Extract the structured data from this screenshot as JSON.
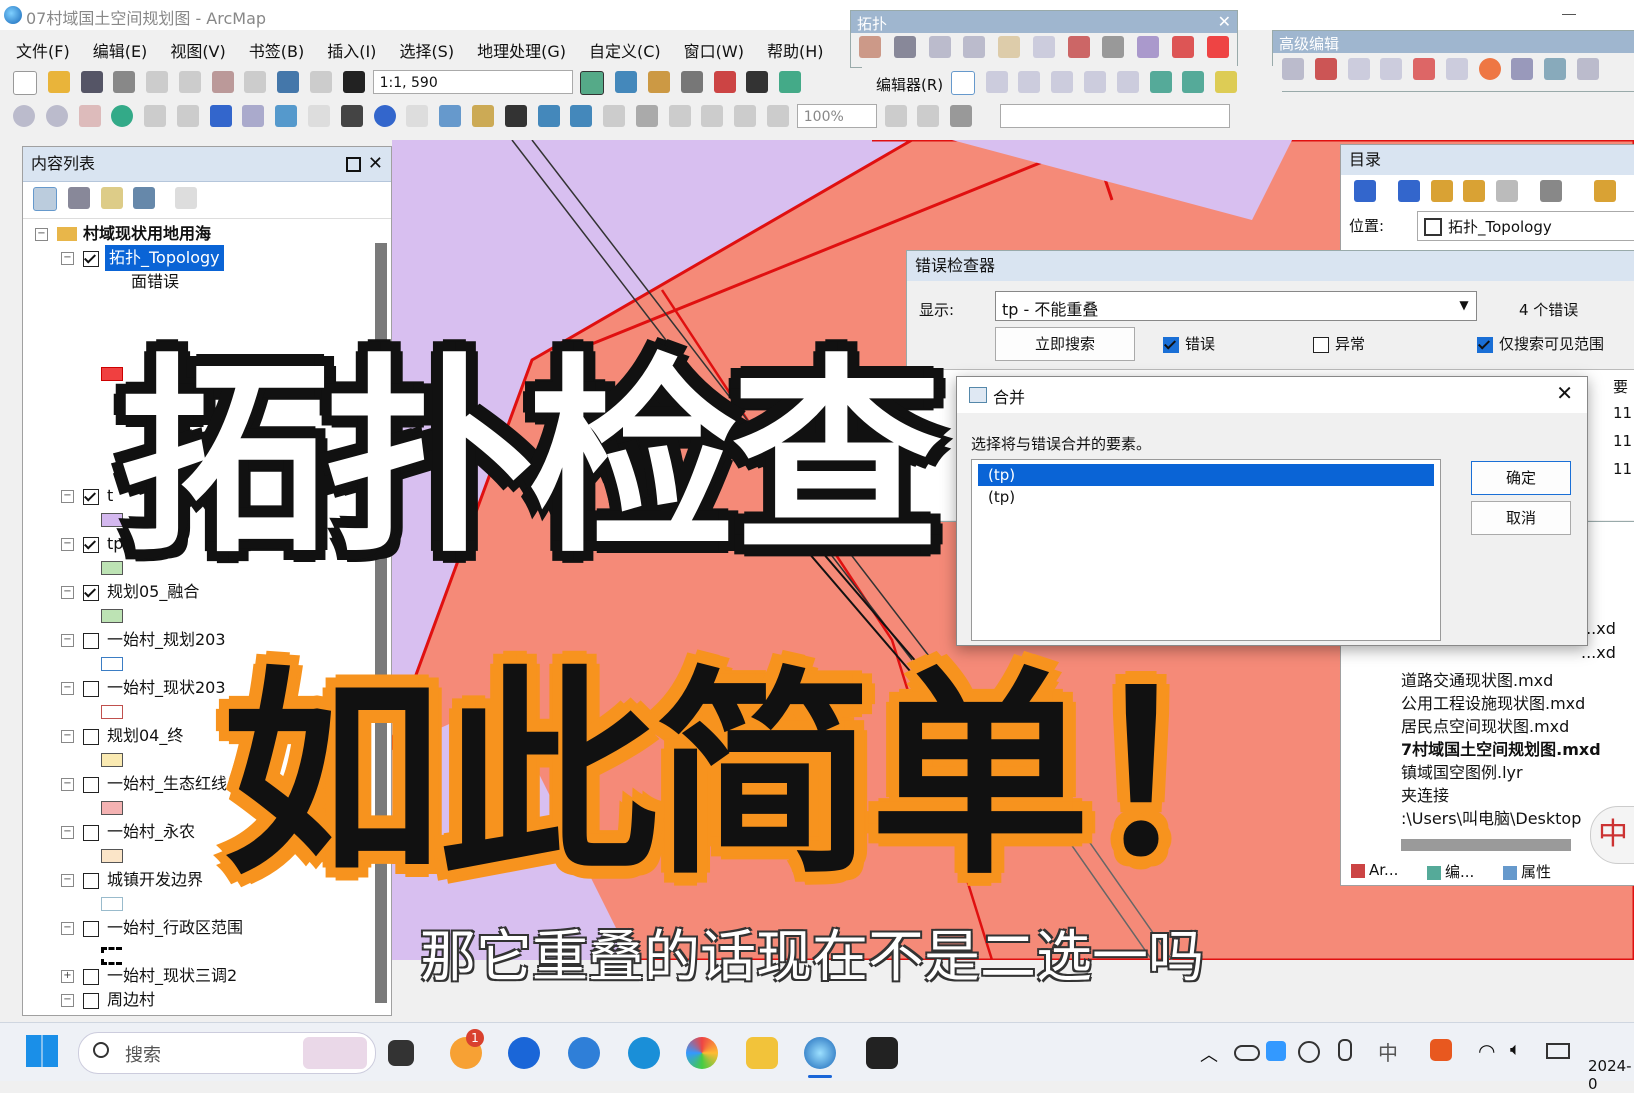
{
  "window": {
    "title": "07村域国土空间规划图 - ArcMap"
  },
  "menu": [
    "文件(F)",
    "编辑(E)",
    "视图(V)",
    "书签(B)",
    "插入(I)",
    "选择(S)",
    "地理处理(G)",
    "自定义(C)",
    "窗口(W)",
    "帮助(H)"
  ],
  "toolbar": {
    "scale": "1:1, 590",
    "editor_label": "编辑器(R)",
    "zoom_percent": "100%"
  },
  "topology_toolbar": {
    "title": "拓扑"
  },
  "advanced_edit_toolbar": {
    "title": "高级编辑"
  },
  "toc": {
    "title": "内容列表",
    "root": "村域现状用地用海",
    "selected_layer": "拓扑_Topology",
    "sublabel": "面错误",
    "layers": [
      {
        "label": "t",
        "checked": true
      },
      {
        "label": "tp",
        "checked": true
      },
      {
        "label": "规划05_融合",
        "checked": true
      },
      {
        "label": "一始村_规划203",
        "checked": false
      },
      {
        "label": "一始村_现状203",
        "checked": false
      },
      {
        "label": "规划04_终",
        "checked": false
      },
      {
        "label": "一始村_生态红线",
        "checked": false
      },
      {
        "label": "一始村_永农",
        "checked": false
      },
      {
        "label": "城镇开发边界",
        "checked": false
      },
      {
        "label": "一始村_行政区范围",
        "checked": false
      },
      {
        "label": "一始村_现状三调2",
        "checked": false
      },
      {
        "label": "周边村",
        "checked": false
      }
    ]
  },
  "catalog": {
    "title": "目录",
    "location_label": "位置:",
    "location_value": "拓扑_Topology",
    "items": [
      "...xd",
      "...xd",
      "道路交通现状图.mxd",
      "公用工程设施现状图.mxd",
      "居民点空间现状图.mxd",
      "7村域国土空间规划图.mxd",
      "镇域国空图例.lyr",
      "夹连接",
      ":\\Users\\叫电脑\\Desktop"
    ],
    "tabs": [
      "Ar...",
      "编...",
      "属性"
    ]
  },
  "error_inspector": {
    "title": "错误检查器",
    "show_label": "显示:",
    "show_value": "tp - 不能重叠",
    "error_count": "4 个错误",
    "search_now": "立即搜索",
    "opt_errors": "错误",
    "opt_exceptions": "异常",
    "opt_visible": "仅搜索可见范围",
    "col_partial": "要",
    "values": [
      "11",
      "11",
      "11"
    ]
  },
  "merge_dialog": {
    "title": "合并",
    "prompt": "选择将与错误合并的要素。",
    "items": [
      "(tp)",
      "(tp)"
    ],
    "ok": "确定",
    "cancel": "取消"
  },
  "overlay": {
    "headline": "拓扑检查",
    "headline2": "如此简单！",
    "subtitle": "那它重叠的话现在不是二选一吗"
  },
  "taskbar": {
    "search": "搜索",
    "notification_badge": "1",
    "time_partial": "2024-0"
  },
  "ime": "中"
}
